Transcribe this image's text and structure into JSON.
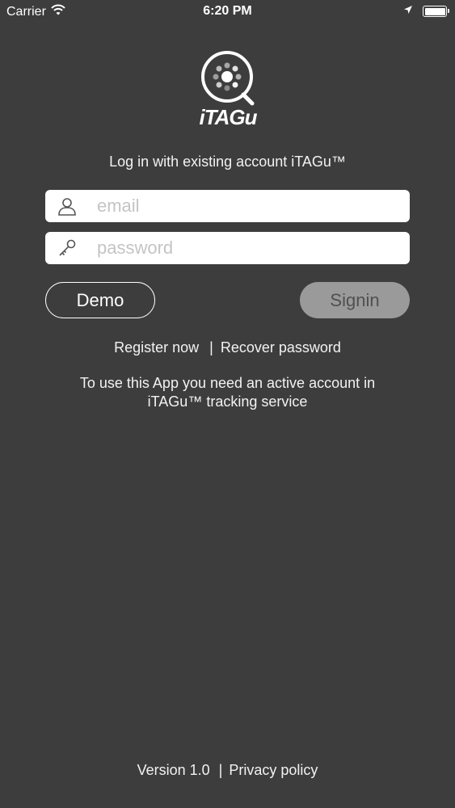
{
  "status_bar": {
    "carrier": "Carrier",
    "time": "6:20 PM"
  },
  "logo": {
    "text": "iTAGu"
  },
  "heading": "Log in with existing account iTAGu™",
  "form": {
    "email_placeholder": "email",
    "password_placeholder": "password"
  },
  "buttons": {
    "demo": "Demo",
    "signin": "Signin"
  },
  "links": {
    "register": "Register now",
    "separator": "|",
    "recover": "Recover password"
  },
  "info": {
    "line1": "To use this App you need an active account in",
    "line2": "iTAGu™ tracking service"
  },
  "footer": {
    "version": "Version 1.0",
    "separator": "|",
    "privacy": "Privacy policy"
  },
  "colors": {
    "background": "#3d3d3d",
    "signin_button": "#9a9a9a",
    "placeholder": "#c4c4c4"
  }
}
